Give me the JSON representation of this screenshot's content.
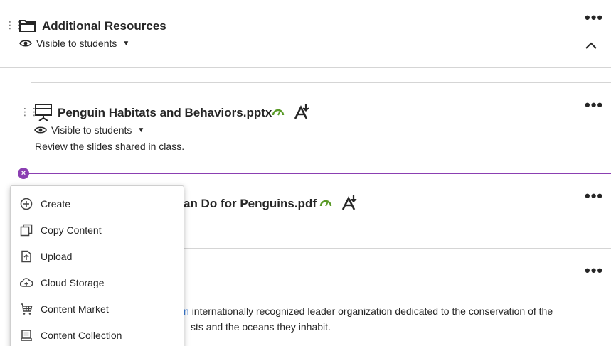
{
  "folder": {
    "title": "Additional Resources",
    "visibility": "Visible to students"
  },
  "item1": {
    "title": "Penguin Habitats and Behaviors.pptx",
    "visibility": "Visible to students",
    "description": "Review the slides shared in class."
  },
  "item2": {
    "title_visible": "an Do for Penguins.pdf"
  },
  "item3": {
    "text_line1": "internationally recognized leader organization dedicated to the conservation of the",
    "text_line2": "sts and the oceans they inhabit."
  },
  "add_menu": {
    "items": [
      {
        "label": "Create",
        "icon": "plus-circle-icon"
      },
      {
        "label": "Copy Content",
        "icon": "copy-icon"
      },
      {
        "label": "Upload",
        "icon": "upload-icon"
      },
      {
        "label": "Cloud Storage",
        "icon": "cloud-icon"
      },
      {
        "label": "Content Market",
        "icon": "cart-icon"
      },
      {
        "label": "Content Collection",
        "icon": "collection-icon"
      }
    ]
  },
  "colors": {
    "accent": "#8b3fb2",
    "status_green": "#5a9a28",
    "divider": "#d5d5d5"
  }
}
